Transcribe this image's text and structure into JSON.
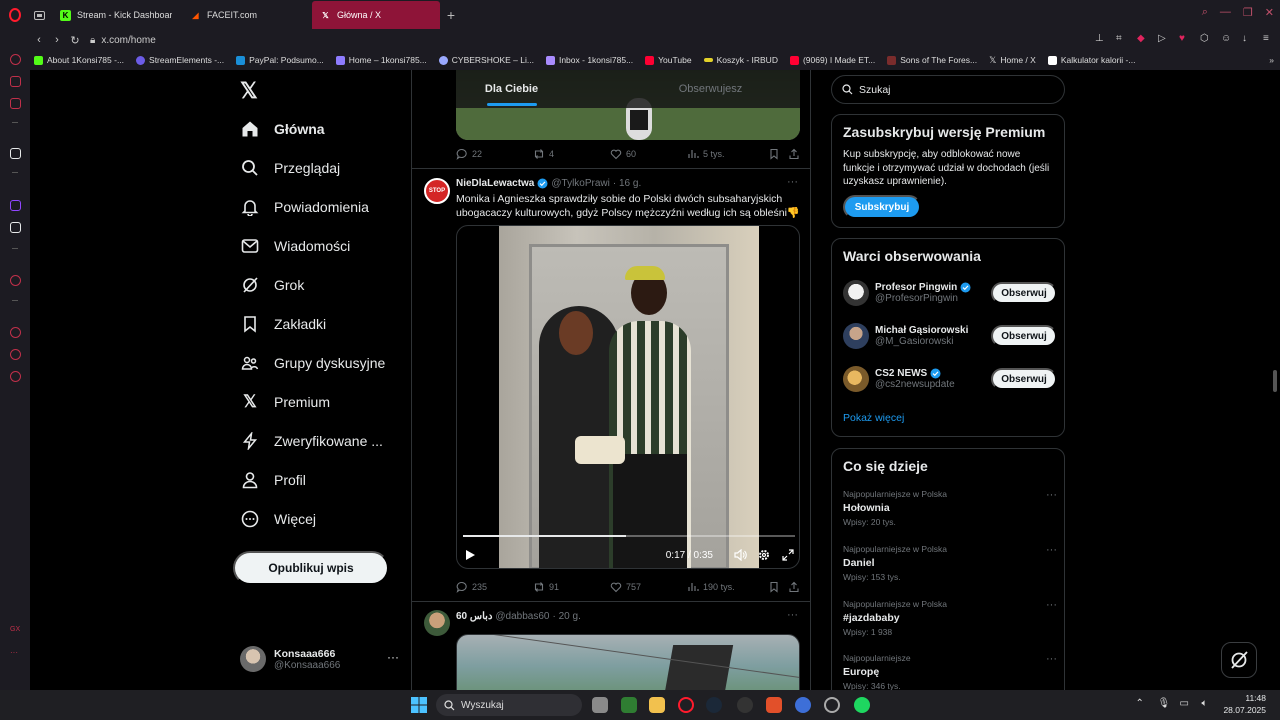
{
  "browser": {
    "tabs": [
      {
        "title": "Stream - Kick Dashboard",
        "icon": "kick-icon",
        "color": "#53fc18"
      },
      {
        "title": "FACEIT.com",
        "icon": "faceit-icon",
        "color": "#ff5500"
      },
      {
        "title": "Główna / X",
        "icon": "x-icon",
        "color": "#ffffff",
        "active": true
      }
    ],
    "url": "x.com/home",
    "bookmarks": [
      {
        "label": "About 1Konsi785 -...",
        "color": "#53fc18"
      },
      {
        "label": "StreamElements -...",
        "color": "#6c5ce7"
      },
      {
        "label": "PayPal: Podsumo...",
        "color": "#1a8fd8"
      },
      {
        "label": "Home – 1konsi785...",
        "color": "#8e7cff"
      },
      {
        "label": "CYBERSHOKE – Li...",
        "color": "#9aa9ff"
      },
      {
        "label": "Inbox - 1konsi785...",
        "color": "#a98bff"
      },
      {
        "label": "YouTube",
        "color": "#ff0033"
      },
      {
        "label": "Koszyk - IRBUD",
        "color": "#e2d12a"
      },
      {
        "label": "(9069) I Made ET...",
        "color": "#ff0033"
      },
      {
        "label": "Sons of The Fores...",
        "color": "#7a2c2c"
      },
      {
        "label": "Home / X",
        "color": "#ffffff"
      },
      {
        "label": "Kalkulator kalorii -...",
        "color": "#ffffff"
      }
    ]
  },
  "nav": {
    "items": [
      {
        "label": "Główna",
        "icon": "home-icon",
        "bold": true
      },
      {
        "label": "Przeglądaj",
        "icon": "search-icon"
      },
      {
        "label": "Powiadomienia",
        "icon": "bell-icon"
      },
      {
        "label": "Wiadomości",
        "icon": "mail-icon"
      },
      {
        "label": "Grok",
        "icon": "grok-icon"
      },
      {
        "label": "Zakładki",
        "icon": "bookmark-icon"
      },
      {
        "label": "Grupy dyskusyjne",
        "icon": "communities-icon"
      },
      {
        "label": "Premium",
        "icon": "x-icon"
      },
      {
        "label": "Zweryfikowane ...",
        "icon": "lightning-icon"
      },
      {
        "label": "Profil",
        "icon": "person-icon"
      },
      {
        "label": "Więcej",
        "icon": "more-circle-icon"
      }
    ],
    "post_label": "Opublikuj wpis",
    "account": {
      "name": "Konsaaa666",
      "handle": "@Konsaaa666"
    }
  },
  "feed": {
    "tabs": [
      "Dla Ciebie",
      "Obserwujesz"
    ],
    "first_post_stats": {
      "replies": "22",
      "reposts": "4",
      "likes": "60",
      "views": "5 tys."
    },
    "post": {
      "name": "NieDlaLewactwa",
      "handle": "@TylkoPrawi",
      "time": "· 16 g.",
      "avatar_text": "STOP",
      "text": "Monika i Agnieszka sprawdziły sobie do Polski dwóch subsaharyjskich ubogacaczy kulturowych, gdyż Polscy mężczyźni według ich są obleśni👎",
      "video": {
        "time": "0:17 / 0:35",
        "progress": 0.49
      },
      "stats": {
        "replies": "235",
        "reposts": "91",
        "likes": "757",
        "views": "190 tys."
      }
    },
    "next_post": {
      "name": "60 دباس",
      "handle": "@dabbas60",
      "time": "· 20 g."
    }
  },
  "right": {
    "search_placeholder": "Szukaj",
    "premium": {
      "title": "Zasubskrybuj wersję Premium",
      "text": "Kup subskrypcję, aby odblokować nowe funkcje i otrzymywać udział w dochodach (jeśli uzyskasz uprawnienie).",
      "button": "Subskrybuj"
    },
    "who_to_follow": {
      "title": "Warci obserwowania",
      "users": [
        {
          "name": "Profesor Pingwin",
          "handle": "@ProfesorPingwin",
          "verified": true,
          "button": "Obserwuj"
        },
        {
          "name": "Michał Gąsiorowski",
          "handle": "@M_Gasiorowski",
          "verified": false,
          "button": "Obserwuj"
        },
        {
          "name": "CS2 NEWS",
          "handle": "@cs2newsupdate",
          "verified": true,
          "button": "Obserwuj"
        }
      ],
      "show_more": "Pokaż więcej"
    },
    "trends": {
      "title": "Co się dzieje",
      "items": [
        {
          "context": "Najpopularniejsze w Polska",
          "topic": "Hołownia",
          "count": "Wpisy: 20 tys."
        },
        {
          "context": "Najpopularniejsze w Polska",
          "topic": "Daniel",
          "count": "Wpisy: 153 tys."
        },
        {
          "context": "Najpopularniejsze w Polska",
          "topic": "#jazdababy",
          "count": "Wpisy: 1 938"
        },
        {
          "context": "Najpopularniejsze",
          "topic": "Europę",
          "count": "Wpisy: 346 tys."
        }
      ]
    }
  },
  "taskbar": {
    "search_label": "Wyszukaj",
    "time": "11:48",
    "date": "28.07.2025"
  }
}
